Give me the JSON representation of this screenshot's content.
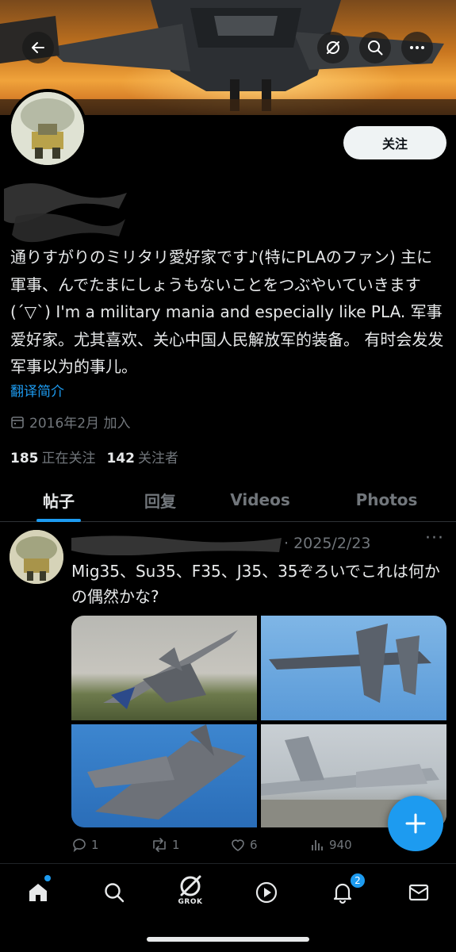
{
  "header": {
    "back_icon": "arrow-left-icon",
    "actions": [
      "translate-off-icon",
      "search-icon",
      "more-icon"
    ]
  },
  "profile": {
    "follow_label": "关注",
    "bio": "通りすがりのミリタリ愛好家です♪(特にPLAのファン) 主に軍事、んでたまにしょうもないことをつぶやいていきます(´▽`) I'm a military mania and especially like PLA. 军事爱好家。尤其喜欢、关心中国人民解放军的装备。 有时会发发军事以为的事儿。",
    "translate_label": "翻译简介",
    "joined": "2016年2月 加入",
    "following_count": "185",
    "following_label": "正在关注",
    "followers_count": "142",
    "followers_label": "关注者"
  },
  "tabs": [
    {
      "label": "帖子",
      "active": true
    },
    {
      "label": "回复",
      "active": false
    },
    {
      "label": "Videos",
      "active": false
    },
    {
      "label": "Photos",
      "active": false
    }
  ],
  "post": {
    "date": "· 2025/2/23",
    "more": "···",
    "text": "Mig35、Su35、F35、J35、35ぞろいでこれは何かの偶然かな?",
    "replies": "1",
    "reposts": "1",
    "likes": "6",
    "views": "940"
  },
  "bottom_nav": {
    "items": [
      "home-icon",
      "search-icon",
      "grok-icon",
      "play-icon",
      "bell-icon",
      "mail-icon"
    ],
    "grok_label": "GROK",
    "notification_count": "2"
  },
  "colors": {
    "accent": "#1d9bf0",
    "background": "#000000",
    "text": "#e7e9ea",
    "muted": "#71767b"
  }
}
